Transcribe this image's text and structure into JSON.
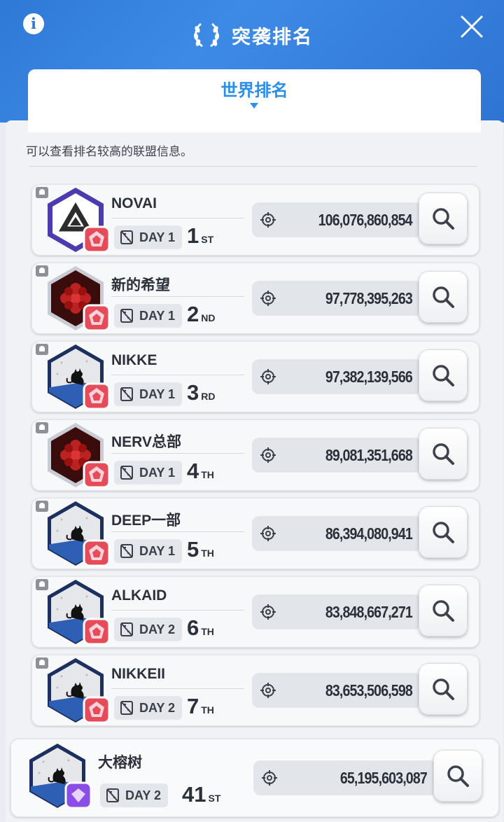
{
  "header": {
    "title": "突袭排名",
    "info_icon": "info-icon",
    "close_icon": "close-icon",
    "wreath_icon": "laurel-wreath-icon",
    "accent_color": "#2e79d6"
  },
  "tab": {
    "label": "世界排名"
  },
  "subtitle": "可以查看排名较高的联盟信息。",
  "rows": [
    {
      "name": "NOVAI",
      "day": "DAY 1",
      "rank": "1",
      "suffix": "ST",
      "score": "106,076,860,854",
      "emblem": "triangle-emblem"
    },
    {
      "name": "新的希望",
      "day": "DAY 1",
      "rank": "2",
      "suffix": "ND",
      "score": "97,778,395,263",
      "emblem": "red-flower-emblem"
    },
    {
      "name": "NIKKE",
      "day": "DAY 1",
      "rank": "3",
      "suffix": "RD",
      "score": "97,382,139,566",
      "emblem": "cat-emblem"
    },
    {
      "name": "NERV总部",
      "day": "DAY 1",
      "rank": "4",
      "suffix": "TH",
      "score": "89,081,351,668",
      "emblem": "red-flower-emblem"
    },
    {
      "name": "DEEP一部",
      "day": "DAY 1",
      "rank": "5",
      "suffix": "TH",
      "score": "86,394,080,941",
      "emblem": "cat-emblem"
    },
    {
      "name": "ALKAID",
      "day": "DAY 2",
      "rank": "6",
      "suffix": "TH",
      "score": "83,848,667,271",
      "emblem": "cat-emblem"
    },
    {
      "name": "NIKKEII",
      "day": "DAY 2",
      "rank": "7",
      "suffix": "TH",
      "score": "83,653,506,598",
      "emblem": "cat-emblem"
    }
  ],
  "my_union": {
    "name": "大榕树",
    "day": "DAY 2",
    "rank": "41",
    "suffix": "ST",
    "score": "65,195,603,087",
    "emblem": "cat-emblem"
  }
}
